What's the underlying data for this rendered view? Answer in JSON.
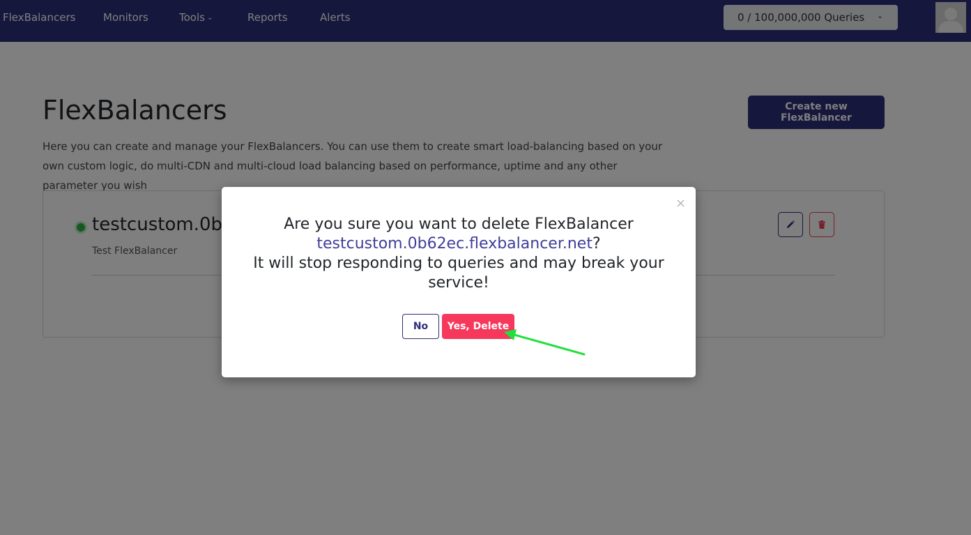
{
  "navbar": {
    "brand": "FlexBalancers",
    "items": [
      {
        "label": "Monitors"
      },
      {
        "label": "Tools"
      },
      {
        "label": "Reports"
      },
      {
        "label": "Alerts"
      }
    ],
    "queries": "0 / 100,000,000  Queries",
    "bg_color": "#2d2e7a"
  },
  "page": {
    "title": "FlexBalancers",
    "create_button": "Create new FlexBalancer",
    "description": "Here you can create and manage your FlexBalancers. You can use them to create smart load-balancing based on your own custom logic, do multi-CDN and multi-cloud load balancing based on performance, uptime and any other parameter you wish"
  },
  "balancer_card": {
    "name": "testcustom.0b",
    "description": "Test FlexBalancer",
    "status_color": "#2db33d"
  },
  "modal": {
    "question_prefix": "Are you sure you want to delete FlexBalancer",
    "domain": "testcustom.0b62ec.flexbalancer.net",
    "question_suffix": "?",
    "warning": "It will stop responding to queries and may break your service!",
    "no_button": "No",
    "yes_button": "Yes, Delete",
    "close_symbol": "×",
    "danger_color": "#f5385c"
  },
  "annotation": {
    "arrow_color": "#22e03a"
  }
}
